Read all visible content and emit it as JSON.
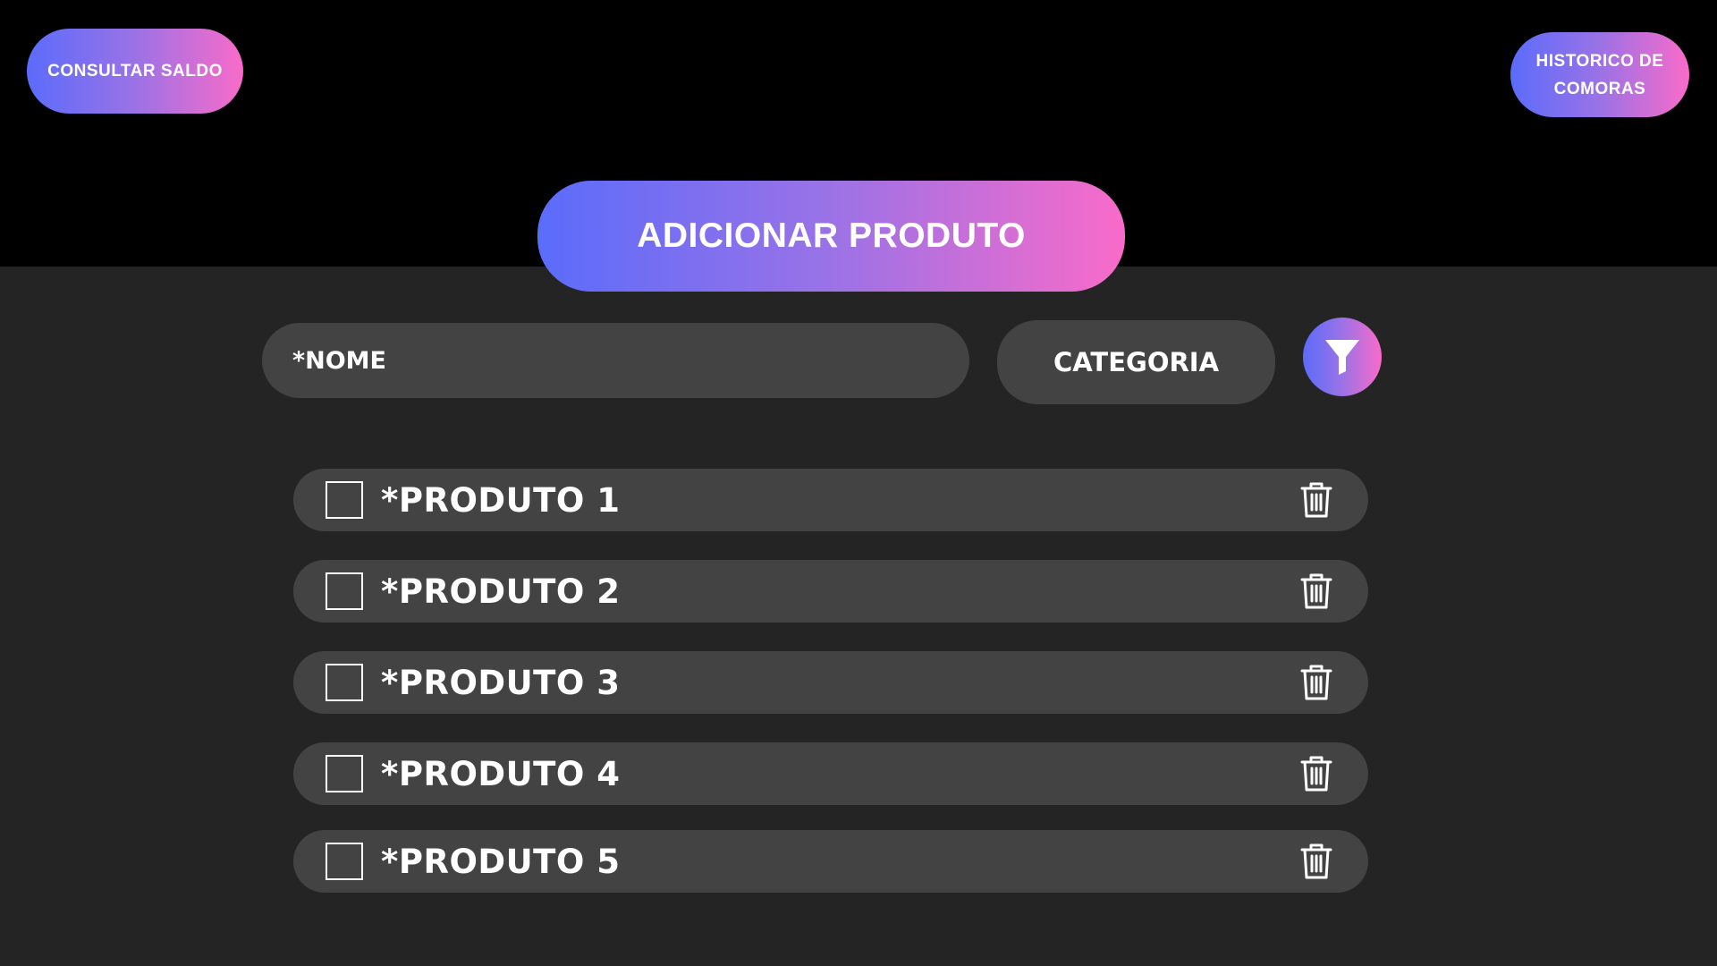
{
  "header": {
    "consultar_saldo": "CONSULTAR SALDO",
    "historico_compras": "HISTORICO DE COMORAS"
  },
  "main": {
    "add_product_label": "ADICIONAR PRODUTO",
    "name_field_placeholder": "*NOME",
    "category_label": "CATEGORIA",
    "filter_icon": "filter-icon"
  },
  "products": [
    {
      "label": "*PRODUTO 1"
    },
    {
      "label": "*PRODUTO 2"
    },
    {
      "label": "*PRODUTO 3"
    },
    {
      "label": "*PRODUTO 4"
    },
    {
      "label": "*PRODUTO 5"
    }
  ],
  "icons": {
    "delete": "trash-icon",
    "checkbox": "checkbox"
  },
  "colors": {
    "gradient_start": "#5b6cfb",
    "gradient_end": "#f96bc9",
    "panel_background": "#242424",
    "field_background": "#434343"
  }
}
